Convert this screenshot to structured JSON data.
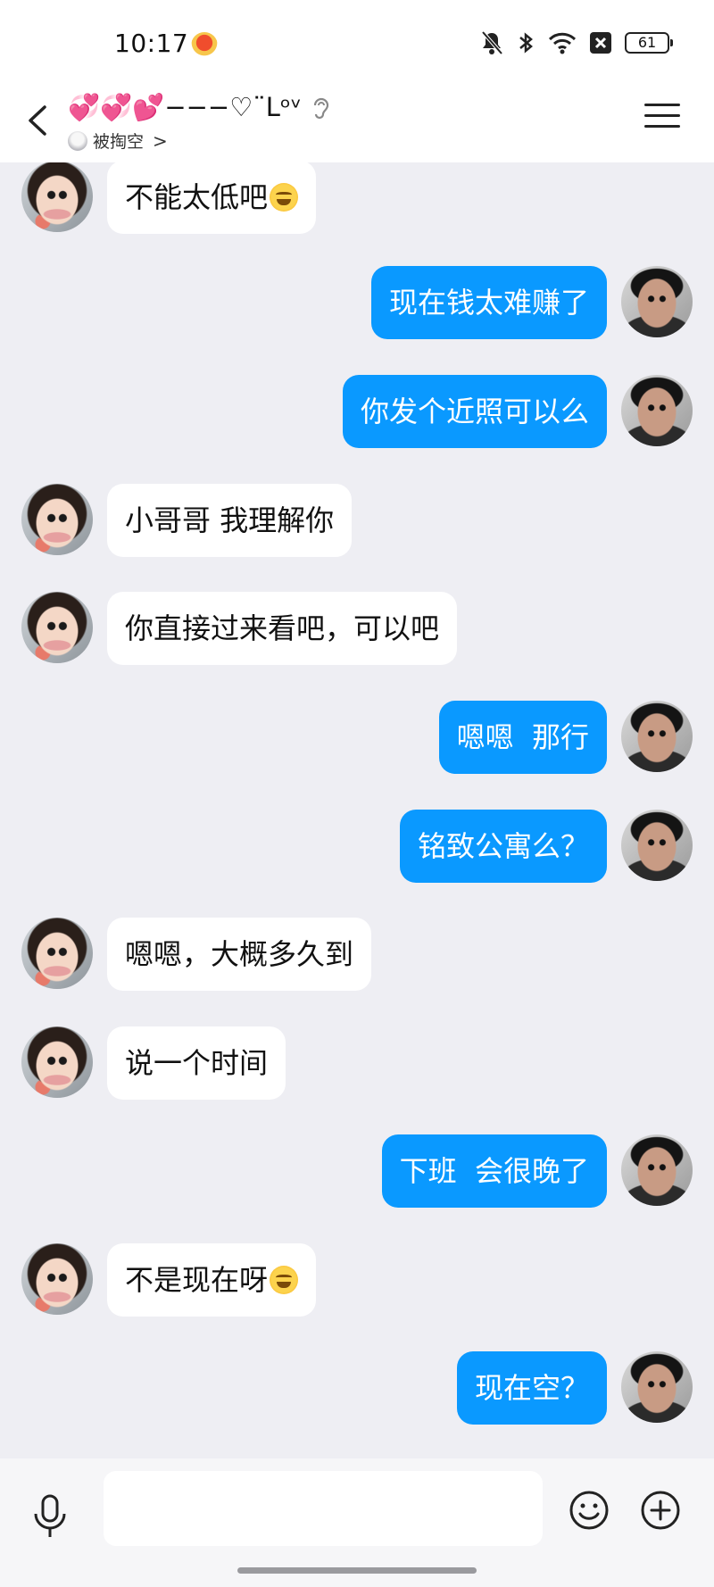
{
  "status_bar": {
    "time": "10:17",
    "battery": "61"
  },
  "header": {
    "contact_name": "💞💞💕−−−♡¨Lᵒᵛ",
    "sub_status": "被掏空",
    "sub_chevron": ">"
  },
  "colors": {
    "sent_bubble": "#0a99ff",
    "received_bubble": "#ffffff",
    "chat_background": "#eeeef3"
  },
  "messages": [
    {
      "side": "left",
      "text": "不能太低吧",
      "emoji": "hand-over-mouth-emoji"
    },
    {
      "side": "right",
      "text": "现在钱太难赚了"
    },
    {
      "side": "right",
      "text": "你发个近照可以么"
    },
    {
      "side": "left",
      "text": "小哥哥 我理解你"
    },
    {
      "side": "left",
      "text": "你直接过来看吧，可以吧"
    },
    {
      "side": "right",
      "text": "嗯嗯  那行"
    },
    {
      "side": "right",
      "text": "铭致公寓么？"
    },
    {
      "side": "left",
      "text": "嗯嗯，大概多久到"
    },
    {
      "side": "left",
      "text": "说一个时间"
    },
    {
      "side": "right",
      "text": "下班  会很晚了"
    },
    {
      "side": "left",
      "text": "不是现在呀",
      "emoji": "grinning-emoji"
    },
    {
      "side": "right",
      "text": "现在空？"
    }
  ],
  "input": {
    "value": "",
    "placeholder": ""
  }
}
